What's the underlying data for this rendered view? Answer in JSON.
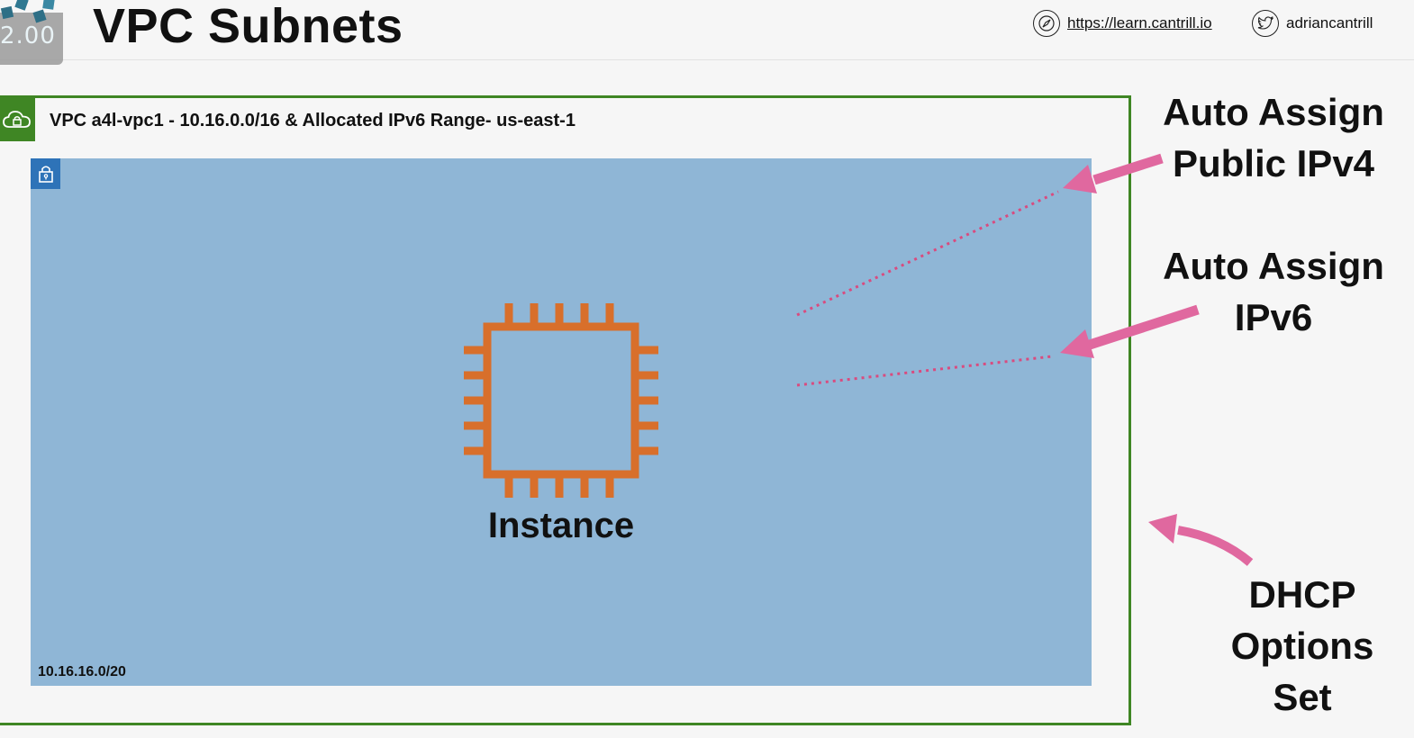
{
  "header": {
    "logo_text": "2.00",
    "title": "VPC Subnets",
    "website": "https://learn.cantrill.io",
    "twitter_handle": "adriancantrill"
  },
  "vpc": {
    "label": "VPC a4l-vpc1 - 10.16.0.0/16 & Allocated IPv6 Range- us-east-1",
    "border_color": "#3f8624",
    "icon": "cloud-lock-icon"
  },
  "subnet": {
    "cidr": "10.16.16.0/20",
    "fill_color": "#8fb6d6",
    "icon": "lock-icon"
  },
  "instance": {
    "label": "Instance",
    "icon": "chip-icon",
    "color": "#d86f2b"
  },
  "annotations": {
    "auto_assign_ipv4": [
      "Auto Assign",
      "Public IPv4"
    ],
    "auto_assign_ipv6": [
      "Auto Assign",
      "IPv6"
    ],
    "dhcp_options": [
      "DHCP",
      "Options",
      "Set"
    ],
    "arrow_color": "#e0689f"
  }
}
